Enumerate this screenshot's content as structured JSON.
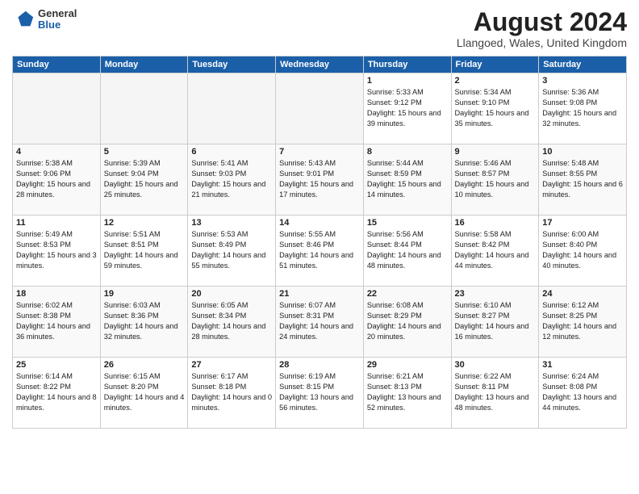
{
  "header": {
    "logo_general": "General",
    "logo_blue": "Blue",
    "month_title": "August 2024",
    "location": "Llangoed, Wales, United Kingdom"
  },
  "columns": [
    "Sunday",
    "Monday",
    "Tuesday",
    "Wednesday",
    "Thursday",
    "Friday",
    "Saturday"
  ],
  "weeks": [
    [
      {
        "day": "",
        "empty": true
      },
      {
        "day": "",
        "empty": true
      },
      {
        "day": "",
        "empty": true
      },
      {
        "day": "",
        "empty": true
      },
      {
        "day": "1",
        "sunrise": "Sunrise: 5:33 AM",
        "sunset": "Sunset: 9:12 PM",
        "daylight": "Daylight: 15 hours and 39 minutes."
      },
      {
        "day": "2",
        "sunrise": "Sunrise: 5:34 AM",
        "sunset": "Sunset: 9:10 PM",
        "daylight": "Daylight: 15 hours and 35 minutes."
      },
      {
        "day": "3",
        "sunrise": "Sunrise: 5:36 AM",
        "sunset": "Sunset: 9:08 PM",
        "daylight": "Daylight: 15 hours and 32 minutes."
      }
    ],
    [
      {
        "day": "4",
        "sunrise": "Sunrise: 5:38 AM",
        "sunset": "Sunset: 9:06 PM",
        "daylight": "Daylight: 15 hours and 28 minutes."
      },
      {
        "day": "5",
        "sunrise": "Sunrise: 5:39 AM",
        "sunset": "Sunset: 9:04 PM",
        "daylight": "Daylight: 15 hours and 25 minutes."
      },
      {
        "day": "6",
        "sunrise": "Sunrise: 5:41 AM",
        "sunset": "Sunset: 9:03 PM",
        "daylight": "Daylight: 15 hours and 21 minutes."
      },
      {
        "day": "7",
        "sunrise": "Sunrise: 5:43 AM",
        "sunset": "Sunset: 9:01 PM",
        "daylight": "Daylight: 15 hours and 17 minutes."
      },
      {
        "day": "8",
        "sunrise": "Sunrise: 5:44 AM",
        "sunset": "Sunset: 8:59 PM",
        "daylight": "Daylight: 15 hours and 14 minutes."
      },
      {
        "day": "9",
        "sunrise": "Sunrise: 5:46 AM",
        "sunset": "Sunset: 8:57 PM",
        "daylight": "Daylight: 15 hours and 10 minutes."
      },
      {
        "day": "10",
        "sunrise": "Sunrise: 5:48 AM",
        "sunset": "Sunset: 8:55 PM",
        "daylight": "Daylight: 15 hours and 6 minutes."
      }
    ],
    [
      {
        "day": "11",
        "sunrise": "Sunrise: 5:49 AM",
        "sunset": "Sunset: 8:53 PM",
        "daylight": "Daylight: 15 hours and 3 minutes."
      },
      {
        "day": "12",
        "sunrise": "Sunrise: 5:51 AM",
        "sunset": "Sunset: 8:51 PM",
        "daylight": "Daylight: 14 hours and 59 minutes."
      },
      {
        "day": "13",
        "sunrise": "Sunrise: 5:53 AM",
        "sunset": "Sunset: 8:49 PM",
        "daylight": "Daylight: 14 hours and 55 minutes."
      },
      {
        "day": "14",
        "sunrise": "Sunrise: 5:55 AM",
        "sunset": "Sunset: 8:46 PM",
        "daylight": "Daylight: 14 hours and 51 minutes."
      },
      {
        "day": "15",
        "sunrise": "Sunrise: 5:56 AM",
        "sunset": "Sunset: 8:44 PM",
        "daylight": "Daylight: 14 hours and 48 minutes."
      },
      {
        "day": "16",
        "sunrise": "Sunrise: 5:58 AM",
        "sunset": "Sunset: 8:42 PM",
        "daylight": "Daylight: 14 hours and 44 minutes."
      },
      {
        "day": "17",
        "sunrise": "Sunrise: 6:00 AM",
        "sunset": "Sunset: 8:40 PM",
        "daylight": "Daylight: 14 hours and 40 minutes."
      }
    ],
    [
      {
        "day": "18",
        "sunrise": "Sunrise: 6:02 AM",
        "sunset": "Sunset: 8:38 PM",
        "daylight": "Daylight: 14 hours and 36 minutes."
      },
      {
        "day": "19",
        "sunrise": "Sunrise: 6:03 AM",
        "sunset": "Sunset: 8:36 PM",
        "daylight": "Daylight: 14 hours and 32 minutes."
      },
      {
        "day": "20",
        "sunrise": "Sunrise: 6:05 AM",
        "sunset": "Sunset: 8:34 PM",
        "daylight": "Daylight: 14 hours and 28 minutes."
      },
      {
        "day": "21",
        "sunrise": "Sunrise: 6:07 AM",
        "sunset": "Sunset: 8:31 PM",
        "daylight": "Daylight: 14 hours and 24 minutes."
      },
      {
        "day": "22",
        "sunrise": "Sunrise: 6:08 AM",
        "sunset": "Sunset: 8:29 PM",
        "daylight": "Daylight: 14 hours and 20 minutes."
      },
      {
        "day": "23",
        "sunrise": "Sunrise: 6:10 AM",
        "sunset": "Sunset: 8:27 PM",
        "daylight": "Daylight: 14 hours and 16 minutes."
      },
      {
        "day": "24",
        "sunrise": "Sunrise: 6:12 AM",
        "sunset": "Sunset: 8:25 PM",
        "daylight": "Daylight: 14 hours and 12 minutes."
      }
    ],
    [
      {
        "day": "25",
        "sunrise": "Sunrise: 6:14 AM",
        "sunset": "Sunset: 8:22 PM",
        "daylight": "Daylight: 14 hours and 8 minutes."
      },
      {
        "day": "26",
        "sunrise": "Sunrise: 6:15 AM",
        "sunset": "Sunset: 8:20 PM",
        "daylight": "Daylight: 14 hours and 4 minutes."
      },
      {
        "day": "27",
        "sunrise": "Sunrise: 6:17 AM",
        "sunset": "Sunset: 8:18 PM",
        "daylight": "Daylight: 14 hours and 0 minutes."
      },
      {
        "day": "28",
        "sunrise": "Sunrise: 6:19 AM",
        "sunset": "Sunset: 8:15 PM",
        "daylight": "Daylight: 13 hours and 56 minutes."
      },
      {
        "day": "29",
        "sunrise": "Sunrise: 6:21 AM",
        "sunset": "Sunset: 8:13 PM",
        "daylight": "Daylight: 13 hours and 52 minutes."
      },
      {
        "day": "30",
        "sunrise": "Sunrise: 6:22 AM",
        "sunset": "Sunset: 8:11 PM",
        "daylight": "Daylight: 13 hours and 48 minutes."
      },
      {
        "day": "31",
        "sunrise": "Sunrise: 6:24 AM",
        "sunset": "Sunset: 8:08 PM",
        "daylight": "Daylight: 13 hours and 44 minutes."
      }
    ]
  ]
}
